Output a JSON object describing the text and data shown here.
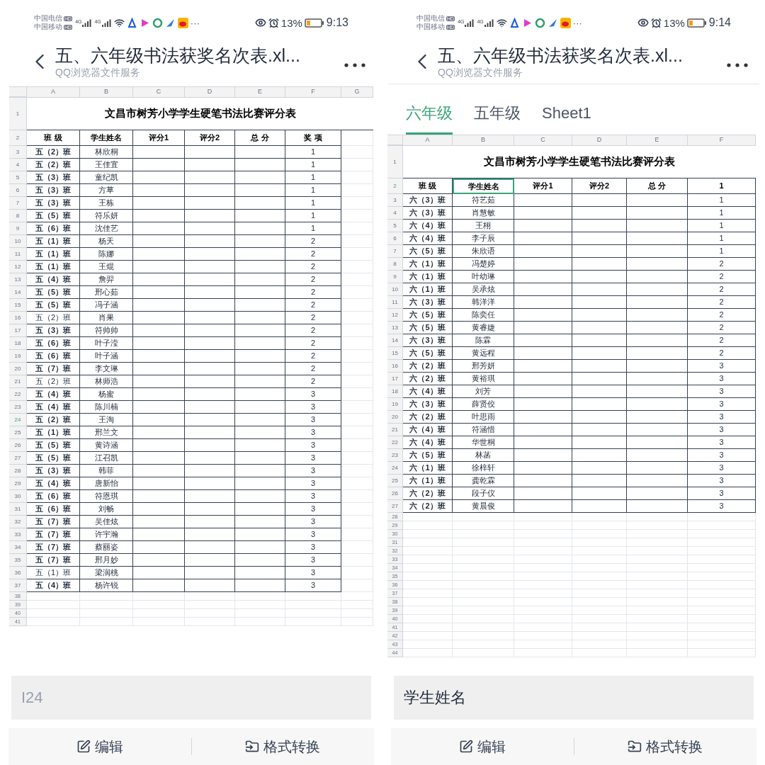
{
  "screens": [
    {
      "status_bar": {
        "carriers": [
          "中国电信",
          "中国移动"
        ],
        "hd_badges": [
          "HD",
          "HD"
        ],
        "network": [
          "4G",
          "4G"
        ],
        "more": "···",
        "battery": "13%",
        "time": "9:13"
      },
      "header": {
        "title": "五、六年级书法获奖名次表.xl...",
        "subtitle": "QQ浏览器文件服务"
      },
      "sheet": {
        "columns": [
          "A",
          "B",
          "C",
          "D",
          "E",
          "F",
          "G"
        ],
        "title_row": {
          "n": "1",
          "text": "文昌市树芳小学学生硬笔书法比赛评分表"
        },
        "header_row": {
          "n": "2",
          "selected": false,
          "cells": [
            {
              "text": "班 级",
              "selected": false
            },
            {
              "text": "学生姓名",
              "selected": false
            },
            {
              "text": "评分1",
              "selected": false
            },
            {
              "text": "评分2",
              "selected": false
            },
            {
              "text": "总 分",
              "selected": false
            },
            {
              "text": "奖 项",
              "selected": false
            }
          ]
        },
        "rows": [
          {
            "n": "3",
            "class": "五（2）班",
            "name": "林欣桐",
            "award": "1",
            "bold": true,
            "selected": false
          },
          {
            "n": "4",
            "class": "五（2）班",
            "name": "王佳宜",
            "award": "1",
            "bold": true,
            "selected": false
          },
          {
            "n": "5",
            "class": "五（3）班",
            "name": "童纪凯",
            "award": "1",
            "bold": true,
            "selected": false
          },
          {
            "n": "6",
            "class": "五（3）班",
            "name": "方草",
            "award": "1",
            "bold": true,
            "selected": false
          },
          {
            "n": "7",
            "class": "五（3）班",
            "name": "王栋",
            "award": "1",
            "bold": true,
            "selected": false
          },
          {
            "n": "8",
            "class": "五（5）班",
            "name": "符乐妍",
            "award": "1",
            "bold": true,
            "selected": false
          },
          {
            "n": "9",
            "class": "五（6）班",
            "name": "沈佳艺",
            "award": "1",
            "bold": true,
            "selected": false
          },
          {
            "n": "10",
            "class": "五（1）班",
            "name": "杨天",
            "award": "2",
            "bold": true,
            "selected": false
          },
          {
            "n": "11",
            "class": "五（1）班",
            "name": "陈娜",
            "award": "2",
            "bold": true,
            "selected": false
          },
          {
            "n": "12",
            "class": "五（1）班",
            "name": "王焜",
            "award": "2",
            "bold": true,
            "selected": false
          },
          {
            "n": "13",
            "class": "五（4）班",
            "name": "詹羿",
            "award": "2",
            "bold": true,
            "selected": false
          },
          {
            "n": "14",
            "class": "五（5）班",
            "name": "邢心茹",
            "award": "2",
            "bold": true,
            "selected": false
          },
          {
            "n": "15",
            "class": "五（5）班",
            "name": "冯子涵",
            "award": "2",
            "bold": true,
            "selected": false
          },
          {
            "n": "16",
            "class": "五（2）班",
            "name": "肖果",
            "award": "2",
            "bold": false,
            "selected": false
          },
          {
            "n": "17",
            "class": "五（3）班",
            "name": "符帅帅",
            "award": "2",
            "bold": true,
            "selected": false
          },
          {
            "n": "18",
            "class": "五（6）班",
            "name": "叶子滢",
            "award": "2",
            "bold": true,
            "selected": false
          },
          {
            "n": "19",
            "class": "五（6）班",
            "name": "叶子涵",
            "award": "2",
            "bold": true,
            "selected": false
          },
          {
            "n": "20",
            "class": "五（7）班",
            "name": "李文琳",
            "award": "2",
            "bold": true,
            "selected": false
          },
          {
            "n": "21",
            "class": "五（2）班",
            "name": "林师浩",
            "award": "2",
            "bold": false,
            "selected": false
          },
          {
            "n": "22",
            "class": "五（4）班",
            "name": "杨蜜",
            "award": "3",
            "bold": true,
            "selected": false
          },
          {
            "n": "23",
            "class": "五（4）班",
            "name": "陈川楠",
            "award": "3",
            "bold": true,
            "selected": false
          },
          {
            "n": "24",
            "class": "五（2）班",
            "name": "王淘",
            "award": "3",
            "bold": true,
            "selected": true
          },
          {
            "n": "25",
            "class": "五（1）班",
            "name": "邢兰文",
            "award": "3",
            "bold": true,
            "selected": false
          },
          {
            "n": "26",
            "class": "五（5）班",
            "name": "黄诗涵",
            "award": "3",
            "bold": true,
            "selected": false
          },
          {
            "n": "27",
            "class": "五（5）班",
            "name": "江召凯",
            "award": "3",
            "bold": true,
            "selected": false
          },
          {
            "n": "28",
            "class": "五（3）班",
            "name": "韩菲",
            "award": "3",
            "bold": true,
            "selected": false
          },
          {
            "n": "29",
            "class": "五（4）班",
            "name": "唐新怡",
            "award": "3",
            "bold": true,
            "selected": false
          },
          {
            "n": "30",
            "class": "五（6）班",
            "name": "符恩琪",
            "award": "3",
            "bold": true,
            "selected": false
          },
          {
            "n": "31",
            "class": "五（6）班",
            "name": "刘畅",
            "award": "3",
            "bold": true,
            "selected": false
          },
          {
            "n": "32",
            "class": "五（7）班",
            "name": "吴佳炫",
            "award": "3",
            "bold": true,
            "selected": false
          },
          {
            "n": "33",
            "class": "五（7）班",
            "name": "许宇瀚",
            "award": "3",
            "bold": true,
            "selected": false
          },
          {
            "n": "34",
            "class": "五（7）班",
            "name": "蔡丽姿",
            "award": "3",
            "bold": true,
            "selected": false
          },
          {
            "n": "35",
            "class": "五（7）班",
            "name": "邢月妙",
            "award": "3",
            "bold": true,
            "selected": false
          },
          {
            "n": "36",
            "class": "五（1）班",
            "name": "梁润桃",
            "award": "3",
            "bold": false,
            "selected": false
          },
          {
            "n": "37",
            "class": "五（4）班",
            "name": "杨许锐",
            "award": "3",
            "bold": true,
            "selected": false
          }
        ],
        "empty_rows": [
          "38",
          "39",
          "40",
          "41"
        ]
      },
      "cell_field": {
        "placeholder": "I24"
      },
      "actions": [
        "编辑",
        "格式转换"
      ]
    },
    {
      "status_bar": {
        "carriers": [
          "中国电信",
          "中国移动"
        ],
        "hd_badges": [
          "HD",
          "HD"
        ],
        "network": [
          "4G",
          "4G"
        ],
        "more": "···",
        "battery": "13%",
        "time": "9:14"
      },
      "header": {
        "title": "五、六年级书法获奖名次表.xl...",
        "subtitle": "QQ浏览器文件服务"
      },
      "tabs": [
        {
          "label": "六年级",
          "selected": true
        },
        {
          "label": "五年级",
          "selected": false
        },
        {
          "label": "Sheet1",
          "selected": false
        }
      ],
      "sheet": {
        "columns": [
          "A",
          "B",
          "C",
          "D",
          "E",
          "F"
        ],
        "title_row": {
          "n": "1",
          "text": "文昌市树芳小学学生硬笔书法比赛评分表"
        },
        "header_row": {
          "n": "2",
          "selected": true,
          "cells": [
            {
              "text": "班 级",
              "selected": false
            },
            {
              "text": "学生姓名",
              "selected": true
            },
            {
              "text": "评分1",
              "selected": false
            },
            {
              "text": "评分2",
              "selected": false
            },
            {
              "text": "总 分",
              "selected": false
            },
            {
              "text": "1",
              "selected": false
            }
          ]
        },
        "rows": [
          {
            "n": "3",
            "class": "六（3）班",
            "name": "符艺茹",
            "award": "1",
            "bold": true,
            "selected": false
          },
          {
            "n": "4",
            "class": "六（3）班",
            "name": "肖慧敏",
            "award": "1",
            "bold": true,
            "selected": false
          },
          {
            "n": "5",
            "class": "六（4）班",
            "name": "王栩",
            "award": "1",
            "bold": true,
            "selected": false
          },
          {
            "n": "6",
            "class": "六（4）班",
            "name": "李子辰",
            "award": "1",
            "bold": true,
            "selected": false
          },
          {
            "n": "7",
            "class": "六（5）班",
            "name": "朱欣语",
            "award": "1",
            "bold": true,
            "selected": false
          },
          {
            "n": "8",
            "class": "六（1）班",
            "name": "冯楚婷",
            "award": "2",
            "bold": true,
            "selected": false
          },
          {
            "n": "9",
            "class": "六（1）班",
            "name": "叶幼琳",
            "award": "2",
            "bold": true,
            "selected": false
          },
          {
            "n": "10",
            "class": "六（1）班",
            "name": "吴承炫",
            "award": "2",
            "bold": true,
            "selected": false
          },
          {
            "n": "11",
            "class": "六（3）班",
            "name": "韩洋洋",
            "award": "2",
            "bold": true,
            "selected": false
          },
          {
            "n": "12",
            "class": "六（5）班",
            "name": "陈奕任",
            "award": "2",
            "bold": true,
            "selected": false
          },
          {
            "n": "13",
            "class": "六（5）班",
            "name": "黄睿婕",
            "award": "2",
            "bold": true,
            "selected": false
          },
          {
            "n": "14",
            "class": "六（3）班",
            "name": "陈霖",
            "award": "2",
            "bold": true,
            "selected": false
          },
          {
            "n": "15",
            "class": "六（5）班",
            "name": "黄远程",
            "award": "2",
            "bold": true,
            "selected": false
          },
          {
            "n": "16",
            "class": "六（2）班",
            "name": "邢芳妍",
            "award": "3",
            "bold": true,
            "selected": false
          },
          {
            "n": "17",
            "class": "六（2）班",
            "name": "黄裕琪",
            "award": "3",
            "bold": true,
            "selected": false
          },
          {
            "n": "18",
            "class": "六（4）班",
            "name": "刘芳",
            "award": "3",
            "bold": true,
            "selected": false
          },
          {
            "n": "19",
            "class": "六（3）班",
            "name": "薛贤佼",
            "award": "3",
            "bold": true,
            "selected": false
          },
          {
            "n": "20",
            "class": "六（2）班",
            "name": "叶思雨",
            "award": "3",
            "bold": true,
            "selected": false
          },
          {
            "n": "21",
            "class": "六（4）班",
            "name": "符涵惜",
            "award": "3",
            "bold": true,
            "selected": false
          },
          {
            "n": "22",
            "class": "六（4）班",
            "name": "华世桐",
            "award": "3",
            "bold": true,
            "selected": false
          },
          {
            "n": "23",
            "class": "六（5）班",
            "name": "林菡",
            "award": "3",
            "bold": true,
            "selected": false
          },
          {
            "n": "24",
            "class": "六（1）班",
            "name": "徐梓轩",
            "award": "3",
            "bold": true,
            "selected": false
          },
          {
            "n": "25",
            "class": "六（1）班",
            "name": "龚乾霖",
            "award": "3",
            "bold": true,
            "selected": false
          },
          {
            "n": "26",
            "class": "六（2）班",
            "name": "段子仪",
            "award": "3",
            "bold": true,
            "selected": false
          },
          {
            "n": "27",
            "class": "六（2）班",
            "name": "黄晨俊",
            "award": "3",
            "bold": true,
            "selected": false
          }
        ],
        "empty_rows": [
          "28",
          "29",
          "30",
          "31",
          "32",
          "33",
          "34",
          "35",
          "36",
          "37",
          "38",
          "39",
          "40",
          "41",
          "42",
          "43",
          "44"
        ]
      },
      "cell_field": {
        "value": "学生姓名"
      },
      "actions": [
        "编辑",
        "格式转换"
      ]
    }
  ]
}
